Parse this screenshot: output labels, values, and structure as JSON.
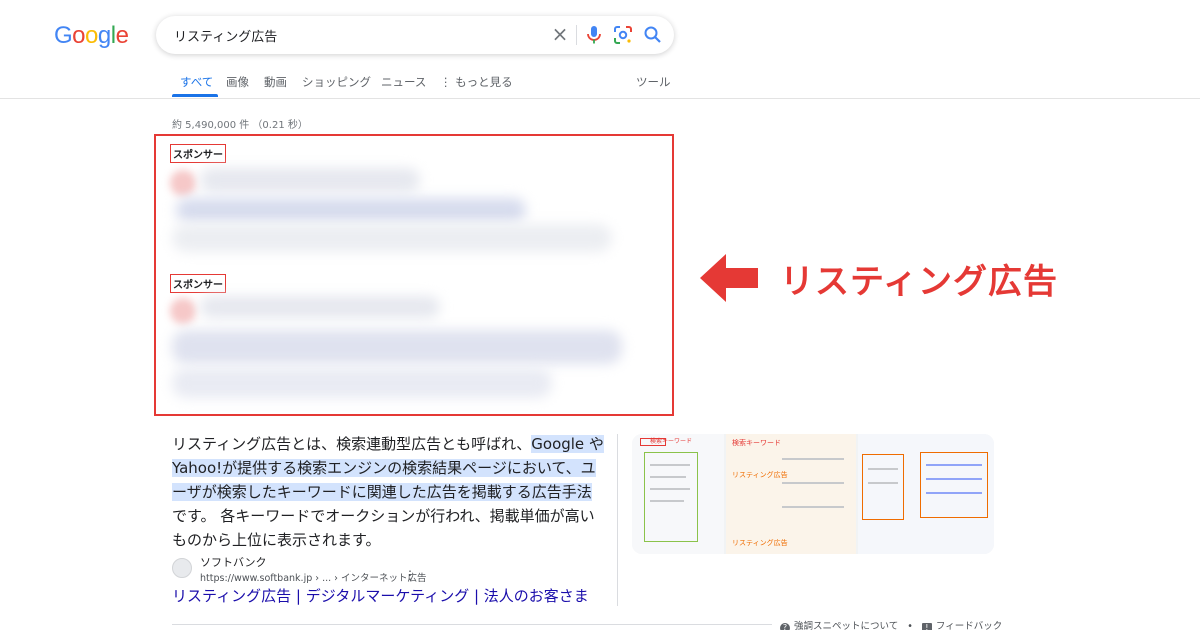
{
  "logo": {
    "letters": [
      "G",
      "o",
      "o",
      "g",
      "l",
      "e"
    ],
    "colors": [
      "#4285f4",
      "#ea4335",
      "#fbbc05",
      "#4285f4",
      "#34a853",
      "#ea4335"
    ]
  },
  "search": {
    "query": "リスティング広告",
    "clear_icon": "×"
  },
  "tabs": [
    {
      "label": "すべて",
      "active": true
    },
    {
      "label": "画像"
    },
    {
      "label": "動画"
    },
    {
      "label": "ショッピング"
    },
    {
      "label": "ニュース"
    },
    {
      "label": "⋮ もっと見る"
    }
  ],
  "tools_label": "ツール",
  "stats": "約 5,490,000 件 （0.21 秒）",
  "ads": [
    {
      "sponsor_label": "スポンサー"
    },
    {
      "sponsor_label": "スポンサー"
    }
  ],
  "annotation": {
    "text": "リスティング広告",
    "color": "#e53935"
  },
  "snippet": {
    "part1": "リスティング広告とは、検索連動型広告とも呼ばれ、",
    "highlight": "Google やYahoo!が提供する検索エンジンの検索結果ページにおいて、ユーザが検索したキーワードに関連した広告を掲載する広告手法",
    "part2": "です。 各キーワードでオークションが行われ、掲載単価が高いものから上位に表示されます。"
  },
  "thumbnails": [
    {
      "label": "検索キーワード"
    },
    {
      "label": "リスティング広告"
    },
    {
      "label": "検索キーワード"
    },
    {
      "label": "リスティング広告"
    }
  ],
  "source": {
    "name": "ソフトバンク",
    "url": "https://www.softbank.jp › ... › インターネット広告",
    "more_icon": "⋮",
    "title": "リスティング広告 | デジタルマーケティング | 法人のお客さま"
  },
  "footer": {
    "snippet_about": "強調スニペットについて",
    "separator": "•",
    "feedback": "フィードバック"
  }
}
